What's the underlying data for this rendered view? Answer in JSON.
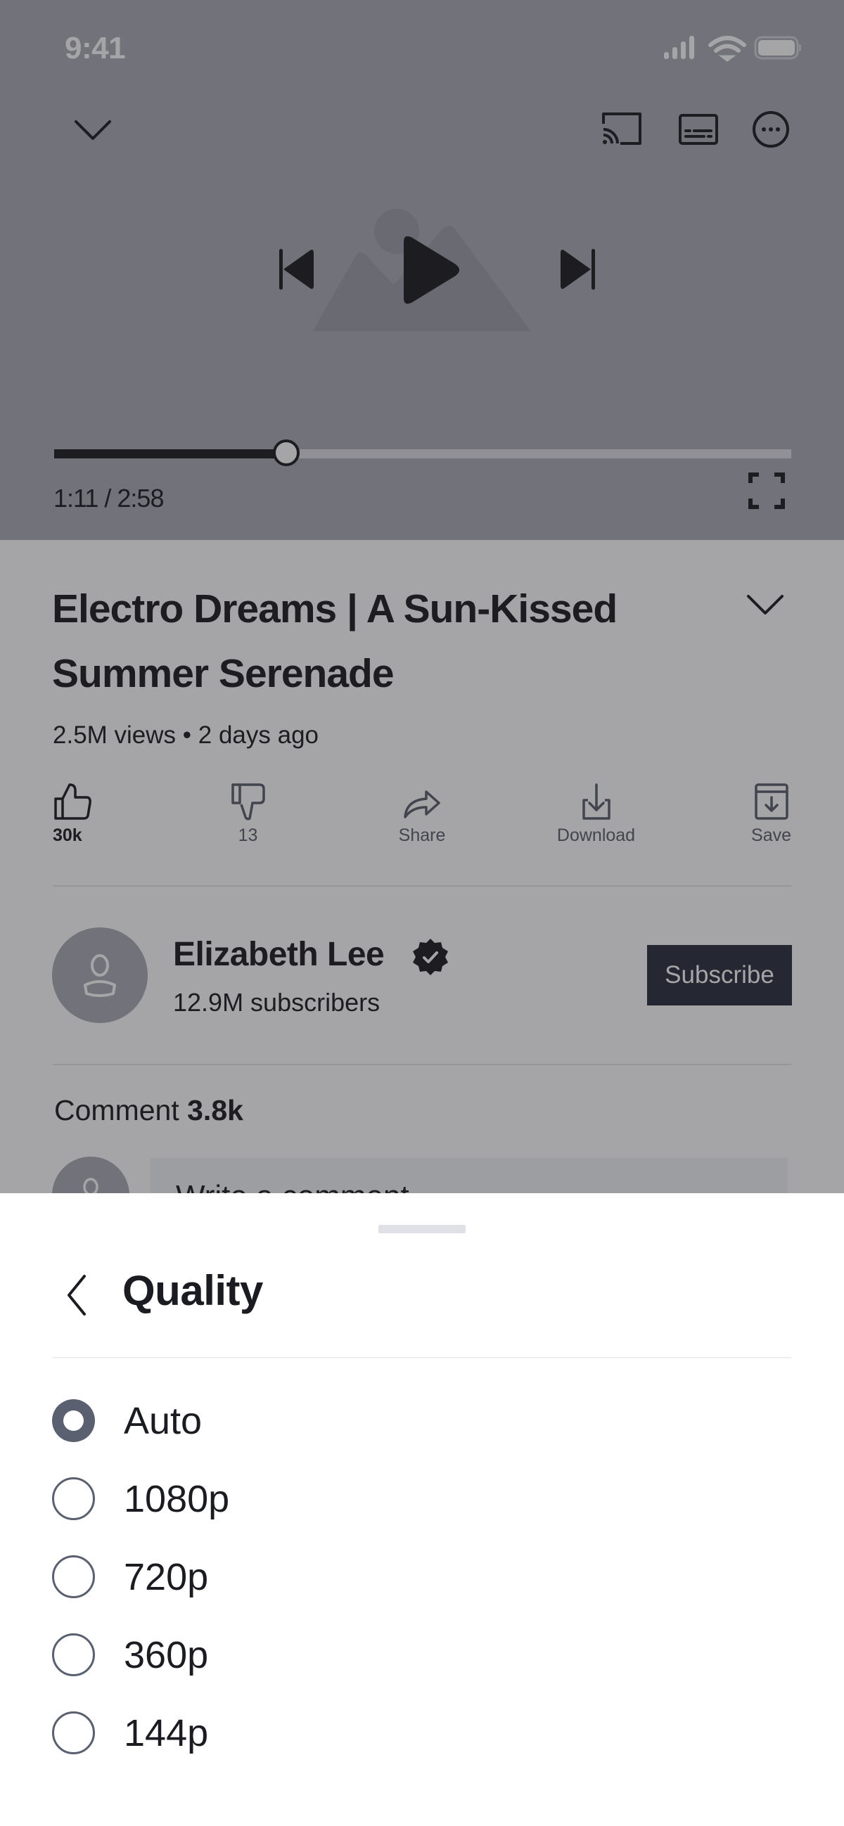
{
  "status_bar": {
    "time": "9:41",
    "icons": [
      "cellular-signal-icon",
      "wifi-icon",
      "battery-icon"
    ]
  },
  "player": {
    "top_bar_icons": [
      "chevron-down-icon",
      "cast-icon",
      "captions-icon",
      "more-options-icon"
    ],
    "controls": [
      "skip-previous-icon",
      "play-icon",
      "skip-next-icon"
    ],
    "progress_fraction": 0.315,
    "current_time": "1:11",
    "duration": "2:58",
    "time_display": "1:11 / 2:58",
    "fullscreen_icon": "fullscreen-icon"
  },
  "video": {
    "title": "Electro Dreams | A Sun-Kissed Summer Serenade",
    "meta": "2.5M views • 2 days ago",
    "actions": [
      {
        "icon": "thumbs-up-icon",
        "label": "30k",
        "active": true
      },
      {
        "icon": "thumbs-down-icon",
        "label": "13",
        "active": false
      },
      {
        "icon": "share-icon",
        "label": "Share",
        "active": false
      },
      {
        "icon": "download-icon",
        "label": "Download",
        "active": false
      },
      {
        "icon": "save-icon",
        "label": "Save",
        "active": false
      }
    ]
  },
  "channel": {
    "name": "Elizabeth Lee",
    "verified": true,
    "subscribers": "12.9M subscribers",
    "subscribe_label": "Subscribe"
  },
  "comments": {
    "label": "Comment",
    "count": "3.8k",
    "input_placeholder": "Write a comment"
  },
  "quality_sheet": {
    "title": "Quality",
    "selected": "Auto",
    "options": [
      {
        "label": "Auto",
        "selected": true
      },
      {
        "label": "1080p",
        "selected": false
      },
      {
        "label": "720p",
        "selected": false
      },
      {
        "label": "360p",
        "selected": false
      },
      {
        "label": "144p",
        "selected": false
      }
    ]
  },
  "colors": {
    "accent": "#5a6070",
    "text_primary": "#1b1c21",
    "scrim": "#1e1f24",
    "sheet_background": "#ffffff",
    "subscribe_button": "#2b2e3c"
  }
}
